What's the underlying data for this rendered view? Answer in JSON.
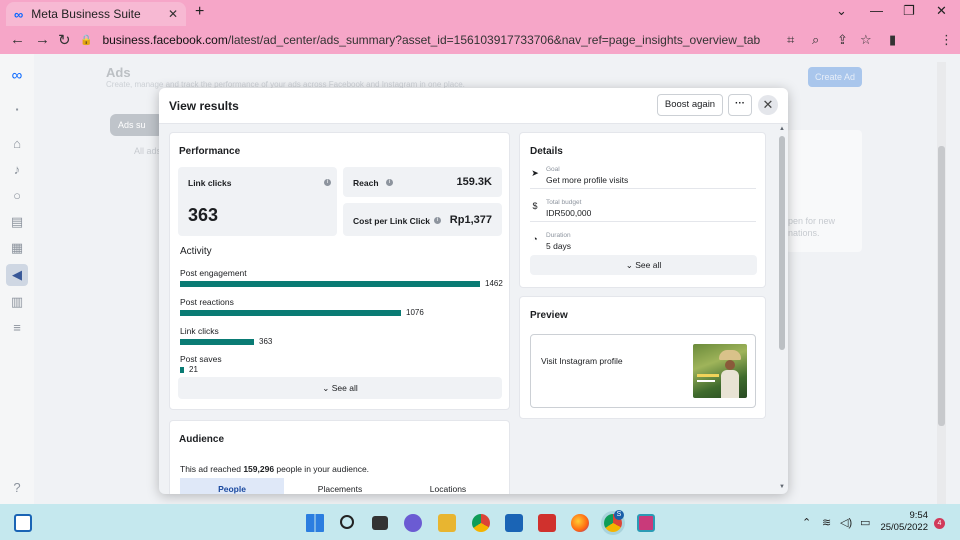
{
  "browser": {
    "tab_title": "Meta Business Suite",
    "tab_close": "✕",
    "new_tab": "+",
    "url_host": "business.facebook.com",
    "url_path": "/latest/ad_center/ads_summary?asset_id=156103917733706&nav_ref=page_insights_overview_tab",
    "profile_initial": "S"
  },
  "background_page": {
    "title": "Ads",
    "subtitle": "Create, manage and track the performance of your ads across Facebook and Instagram in one place.",
    "create_ad": "Create Ad",
    "pill_label": "Ads su",
    "all_ads": "All ads",
    "right_text_1": "pen for new",
    "right_text_2": "nations."
  },
  "modal": {
    "title": "View results",
    "boost_again": "Boost again",
    "more": "···",
    "close": "✕",
    "performance": {
      "title": "Performance",
      "link_clicks_label": "Link clicks",
      "link_clicks_value": "363",
      "reach_label": "Reach",
      "reach_value": "159.3K",
      "cost_label": "Cost per Link Click",
      "cost_value": "Rp1,377",
      "activity_title": "Activity",
      "activity": [
        {
          "label": "Post engagement",
          "value": 1462
        },
        {
          "label": "Post reactions",
          "value": 1076
        },
        {
          "label": "Link clicks",
          "value": 363
        },
        {
          "label": "Post saves",
          "value": 21
        }
      ],
      "see_all": "See all"
    },
    "details": {
      "title": "Details",
      "goal_key": "Goal",
      "goal_value": "Get more profile visits",
      "budget_key": "Total budget",
      "budget_value": "IDR500,000",
      "duration_key": "Duration",
      "duration_value": "5 days",
      "see_all": "See all"
    },
    "preview": {
      "title": "Preview",
      "cta": "Visit Instagram profile"
    },
    "audience": {
      "title": "Audience",
      "text_prefix": "This ad reached ",
      "reached": "159,296",
      "text_suffix": " people in your audience.",
      "tabs": [
        "People",
        "Placements",
        "Locations"
      ]
    }
  },
  "taskbar": {
    "time": "9:54",
    "date": "25/05/2022",
    "notifications": "4",
    "profile_badge": "S"
  },
  "colors": {
    "tabbar": "#f6a6c8",
    "bar_fill": "#0a7b74",
    "taskbar": "#c5e8ee"
  }
}
